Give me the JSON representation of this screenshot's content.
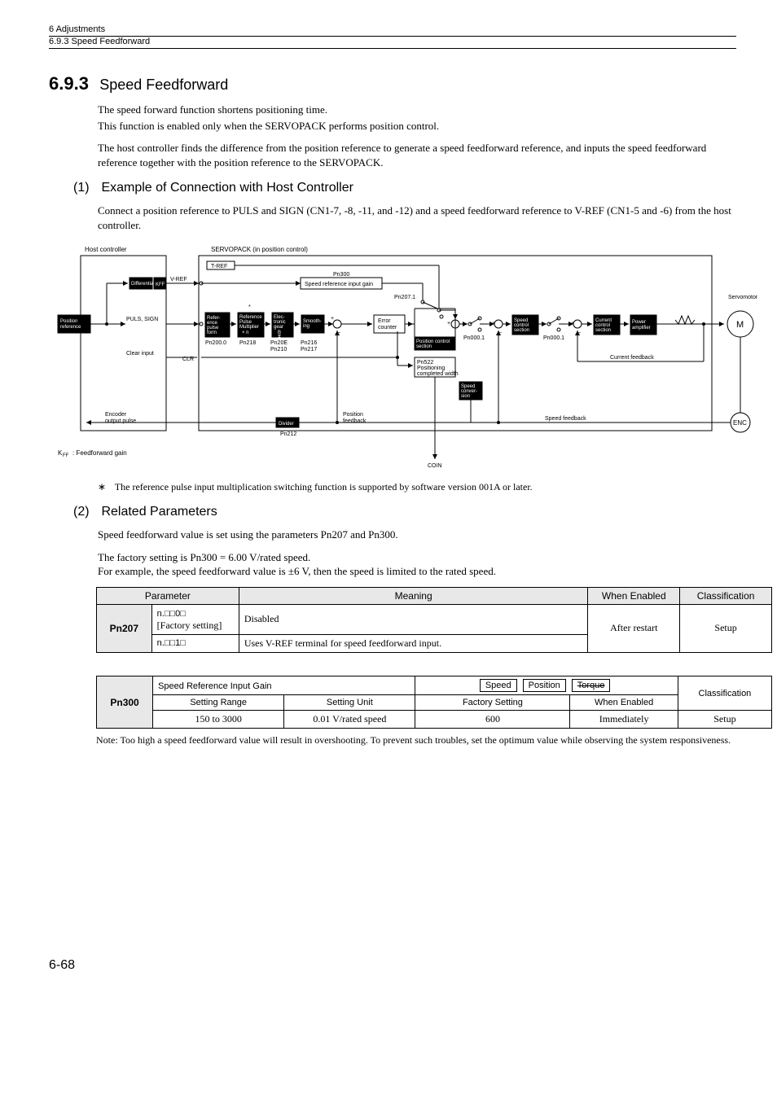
{
  "header": {
    "chapter": "6  Adjustments",
    "section": "6.9.3  Speed Feedforward"
  },
  "section": {
    "number": "6.9.3",
    "title": "Speed Feedforward",
    "intro1": "The speed forward function shortens positioning time.",
    "intro2": "This function is enabled only when the SERVOPACK performs position control.",
    "intro3": "The host controller finds the difference from the position reference to generate a speed feedforward reference, and inputs the speed feedforward reference together with the position reference to the SERVOPACK."
  },
  "sub1": {
    "num": "(1)",
    "title": "Example of Connection with Host Controller",
    "body": "Connect a position reference to PULS and SIGN (CN1-7, -8, -11, and -12) and a speed feedforward reference to V-REF (CN1-5 and -6) from the host controller."
  },
  "diagram": {
    "host_controller": "Host controller",
    "servopack": "SERVOPACK (in position control)",
    "differential": "Differential",
    "kff": "KFF",
    "vref": "V-REF",
    "tref": "T-REF",
    "pn300": "Pn300",
    "speed_ref_gain": "Speed reference input gain",
    "position_reference": "Position reference",
    "puls_sign": "PULS, SIGN",
    "ref_pulse_form": "Reference pulse form",
    "ref_pulse_mult": "Reference Pulse Multiplier × n",
    "elec_gear": "Electronic gear",
    "ba": "B A",
    "smoothing": "Smoothing",
    "error_counter": "Error counter",
    "pos_ctrl_section": "Position control section",
    "speed_ctrl_section": "Speed control section",
    "current_ctrl_section": "Current control section",
    "power_amp": "Power amplifier",
    "servomotor": "Servomotor",
    "m": "M",
    "enc": "ENC",
    "current_feedback": "Current feedback",
    "speed_feedback": "Speed feedback",
    "position_feedback": "Position feedback",
    "encoder_output_pulse": "Encoder output pulse",
    "divider": "Divider",
    "clear_input": "Clear input",
    "clr": "CLR",
    "speed_conv": "Speed conversion",
    "pn2070": "Pn200.0",
    "pn218": "Pn218",
    "pn20e": "Pn20E",
    "pn210": "Pn210",
    "pn216": "Pn216",
    "pn217": "Pn217",
    "pn212": "Pn212",
    "pn2071": "Pn207.1",
    "pn0001a": "Pn000.1",
    "pn0001b": "Pn000.1",
    "pn522": "Pn522",
    "pos_complete": "Positioning completed width",
    "coin": "COIN",
    "kff_caption": "KFF  : Feedforward gain",
    "asterisk": "*"
  },
  "footnote": {
    "mark": "∗",
    "text": "The reference pulse input multiplication switching function is supported by software version 001A or later."
  },
  "sub2": {
    "num": "(2)",
    "title": "Related Parameters",
    "body1": "Speed feedforward value is set using the parameters Pn207 and Pn300.",
    "body2": "The factory setting is Pn300 = 6.00 V/rated speed.",
    "body3": "For example, the speed feedforward value is ±6 V, then the speed is limited to the rated speed."
  },
  "table1": {
    "h_param": "Parameter",
    "h_meaning": "Meaning",
    "h_when": "When Enabled",
    "h_class": "Classification",
    "key": "Pn207",
    "r1c1a": "n.□□0□",
    "r1c1b": "[Factory setting]",
    "r1c2": "Disabled",
    "r2c1": "n.□□1□",
    "r2c2": "Uses V-REF terminal for speed feedforward input.",
    "when": "After restart",
    "class": "Setup"
  },
  "table2": {
    "key": "Pn300",
    "title": "Speed Reference Input Gain",
    "pill_speed": "Speed",
    "pill_position": "Position",
    "pill_torque": "Torque",
    "h_range": "Setting Range",
    "h_unit": "Setting Unit",
    "h_factory": "Factory Setting",
    "h_when": "When Enabled",
    "h_class": "Classification",
    "range": "150 to 3000",
    "unit": "0.01 V/rated speed",
    "factory": "600",
    "when": "Immediately",
    "class": "Setup"
  },
  "note": {
    "label": "Note:",
    "text": "Too high a speed feedforward value will result in overshooting.  To prevent such troubles, set the optimum value while observing the system responsiveness."
  },
  "page": "6-68"
}
